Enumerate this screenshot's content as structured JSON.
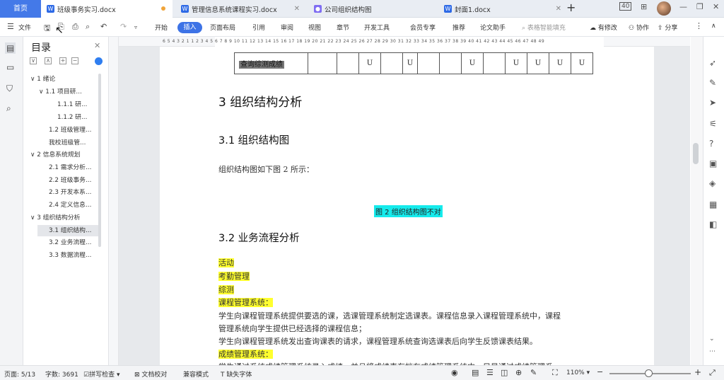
{
  "tabs": {
    "home": "首页",
    "items": [
      {
        "label": "班级事务实习.docx",
        "icon_color": "#2e6ae6",
        "modified": true
      },
      {
        "label": "管理信息系统课程实习.docx",
        "icon_color": "#2e6ae6"
      },
      {
        "label": "公司组织结构图",
        "icon_color": "#7f6df2"
      },
      {
        "label": "封面1.docx",
        "icon_color": "#2e6ae6"
      }
    ],
    "new_tab": "+"
  },
  "window_controls": {
    "badge": "40",
    "layout": "⊞",
    "min": "—",
    "restore": "❐",
    "close": "✕"
  },
  "toolbar": {
    "file": "文件",
    "menus": [
      "开始",
      "插入",
      "页面布局",
      "引用",
      "审阅",
      "视图",
      "章节",
      "开发工具",
      "会员专享",
      "推荐",
      "论文助手"
    ],
    "active_menu": "插入",
    "search_placeholder": "表格智能填充",
    "unsaved": "有修改",
    "collab": "协作",
    "share": "分享"
  },
  "outline": {
    "title": "目录",
    "items": [
      {
        "label": "1  绪论",
        "level": 0,
        "expand": "∨"
      },
      {
        "label": "1.1 项目研...",
        "level": 1,
        "expand": "∨"
      },
      {
        "label": "1.1.1 研...",
        "level": 2
      },
      {
        "label": "1.1.2 研...",
        "level": 2
      },
      {
        "label": "1.2 班级管理...",
        "level": 1
      },
      {
        "label": "我校班级管...",
        "level": 1
      },
      {
        "label": "2 信息系统规划",
        "level": 0,
        "expand": "∨"
      },
      {
        "label": "2.1 需求分析...",
        "level": 1
      },
      {
        "label": "2.2 班级事务...",
        "level": 1
      },
      {
        "label": "2.3 开发本系...",
        "level": 1
      },
      {
        "label": "2.4 定义信息...",
        "level": 1
      },
      {
        "label": "3 组织结构分析",
        "level": 0,
        "expand": "∨"
      },
      {
        "label": "3.1 组织结构...",
        "level": 1,
        "selected": true
      },
      {
        "label": "3.2 业务流程...",
        "level": 1
      },
      {
        "label": "3.3 数据流程...",
        "level": 1
      }
    ]
  },
  "ruler": {
    "marks": "6 5 4 3 2 1     1 2 3 4 5 6 7 8 9 10 11 12 13 14 15 16 17 18 19 20 21 22 23 24 25 26 27 28 29 30 31 32 33 34 35 36 37 38 39 40 41 42 43 44 45 46 47 48 49"
  },
  "document": {
    "table_row": {
      "label": "查询综测成绩",
      "cells": [
        "",
        "",
        "U",
        "",
        "U",
        "",
        "",
        "U",
        "",
        "U",
        "U",
        "U",
        "U"
      ]
    },
    "heading_3": "3 组织结构分析",
    "heading_3_1": "3.1 组织结构图",
    "para_1": "组织结构图如下图 2 所示：",
    "figure_caption": "图 2 组织结构图不对",
    "heading_3_2": "3.2 业务流程分析",
    "hl_1": "活动",
    "hl_2": "考勤管理",
    "hl_3": "综测",
    "hl_4": "课程管理系统：",
    "para_2a": "学生向课程管理系统提供要选的课，选课管理系统制定选课表。课程信息录入课程管理系统中，课程",
    "para_2b": "管理系统向学生提供已经选择的课程信息；",
    "para_3": "学生向课程管理系统发出查询课表的请求，课程管理系统查询选课表后向学生反馈课表结果。",
    "hl_5": "成绩管理系统：",
    "para_4": "学生通过系统成绩管理系统录入成绩，并且将成绩表存档在成绩管理系统中，目是通过成绩管理系"
  },
  "status": {
    "page": "页面: 5/13",
    "words": "字数: 3691",
    "spell": "拼写检查",
    "proof": "文档校对",
    "compat": "兼容模式",
    "missing_font": "缺失字体",
    "zoom": "110%"
  }
}
